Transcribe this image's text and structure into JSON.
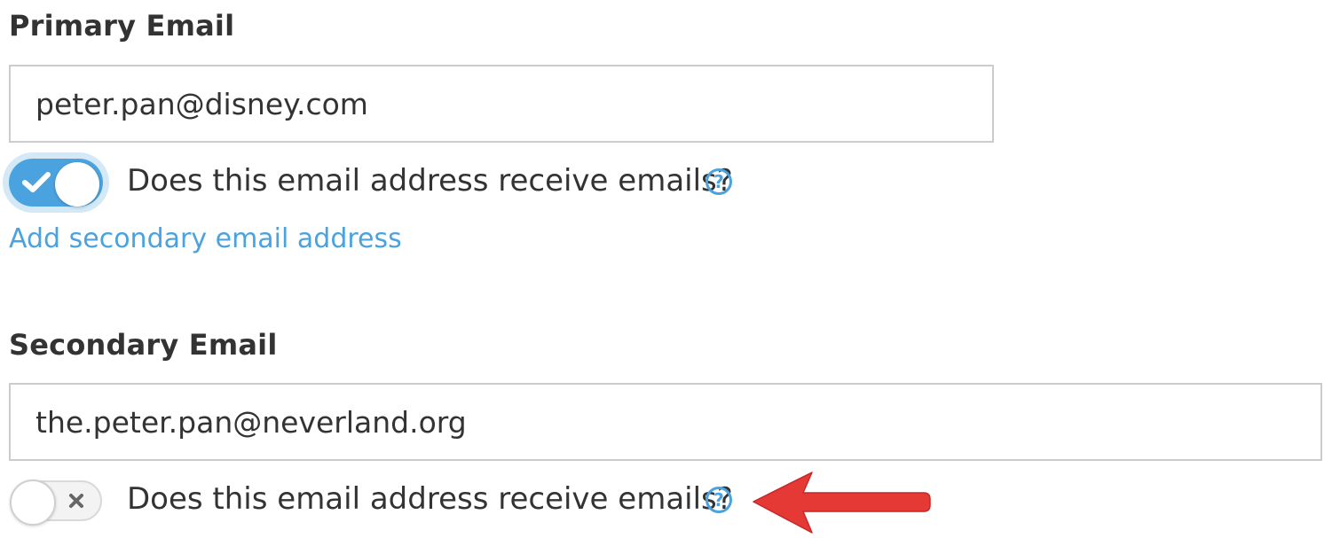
{
  "primary": {
    "title": "Primary Email",
    "email_value": "peter.pan@disney.com",
    "receive_emails_enabled": true,
    "question": "Does this email address receive emails?",
    "help_glyph": "?",
    "add_secondary_link": "Add secondary email address"
  },
  "secondary": {
    "title": "Secondary Email",
    "email_value": "the.peter.pan@neverland.org",
    "receive_emails_enabled": false,
    "question": "Does this email address receive emails?",
    "help_glyph": "?"
  },
  "icons": {
    "toggle_on": "checkmark-icon",
    "toggle_off": "x-icon",
    "help": "question-circle-icon",
    "annotation": "red-arrow-left-icon"
  },
  "colors": {
    "accent": "#4aa3df",
    "annotation_arrow": "#e53935",
    "text": "#333333"
  }
}
